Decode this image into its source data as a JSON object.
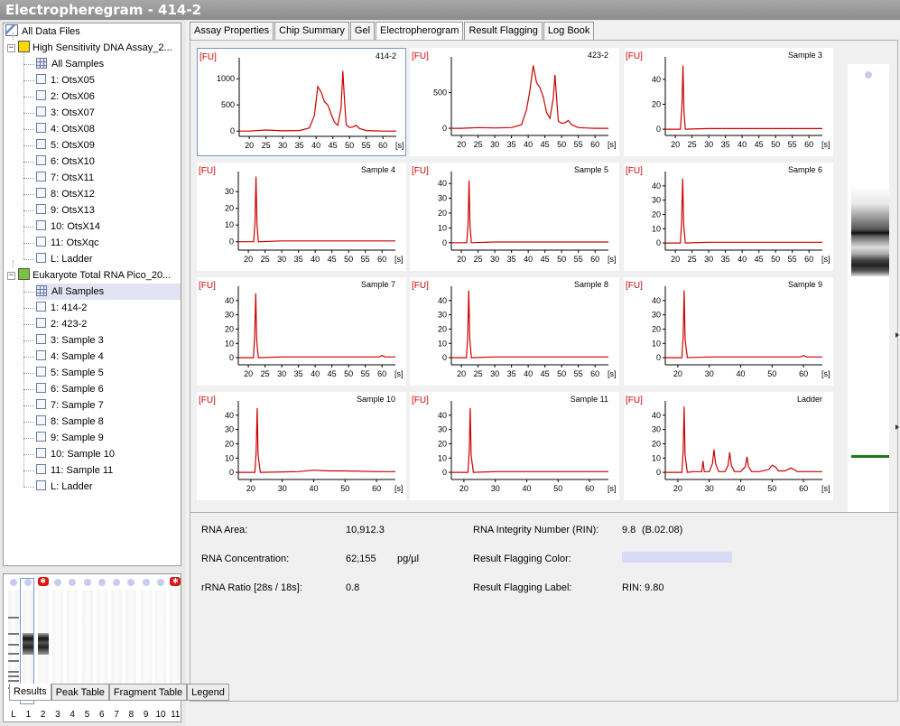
{
  "window": {
    "title": "Electropheregram - 414-2"
  },
  "tree": {
    "root": "All Data Files",
    "assay1": {
      "label": "High Sensitivity DNA Assay_2...",
      "items": [
        "All Samples",
        "1: OtsX05",
        "2: OtsX06",
        "3: OtsX07",
        "4: OtsX08",
        "5: OtsX09",
        "6: OtsX10",
        "7: OtsX11",
        "8: OtsX12",
        "9: OtsX13",
        "10: OtsX14",
        "11: OtsXqc",
        "L: Ladder"
      ]
    },
    "assay2": {
      "label": "Eukaryote Total RNA Pico_20...",
      "items": [
        "All Samples",
        "1: 414-2",
        "2: 423-2",
        "3: Sample 3",
        "4: Sample 4",
        "5: Sample 5",
        "6: Sample 6",
        "7: Sample 7",
        "8: Sample 8",
        "9: Sample 9",
        "10: Sample 10",
        "11: Sample 11",
        "L: Ladder"
      ]
    }
  },
  "gel_lanes": [
    "L",
    "1",
    "2",
    "3",
    "4",
    "5",
    "6",
    "7",
    "8",
    "9",
    "10",
    "11"
  ],
  "tabs": [
    "Assay Properties",
    "Chip Summary",
    "Gel",
    "Electropherogram",
    "Result Flagging",
    "Log Book"
  ],
  "active_tab": "Electropherogram",
  "plots": {
    "y_unit": "[FU]",
    "x_unit": "[s]",
    "cells": [
      {
        "title": "414-2",
        "yticks": [
          "1000",
          "500",
          "0"
        ],
        "xticks": [
          "20",
          "25",
          "30",
          "35",
          "40",
          "45",
          "50",
          "55",
          "60"
        ]
      },
      {
        "title": "423-2",
        "yticks": [
          "500",
          "0"
        ],
        "xticks": [
          "20",
          "25",
          "30",
          "35",
          "40",
          "45",
          "50",
          "55",
          "60"
        ]
      },
      {
        "title": "Sample 3",
        "yticks": [
          "40",
          "20",
          "0"
        ],
        "xticks": [
          "20",
          "25",
          "30",
          "35",
          "40",
          "45",
          "50",
          "55",
          "60"
        ]
      },
      {
        "title": "Sample 4",
        "yticks": [
          "30",
          "20",
          "10",
          "0"
        ],
        "xticks": [
          "20",
          "25",
          "30",
          "35",
          "40",
          "45",
          "50",
          "55",
          "60"
        ]
      },
      {
        "title": "Sample 5",
        "yticks": [
          "40",
          "30",
          "20",
          "10",
          "0"
        ],
        "xticks": [
          "20",
          "25",
          "30",
          "35",
          "40",
          "45",
          "50",
          "55",
          "60"
        ]
      },
      {
        "title": "Sample 6",
        "yticks": [
          "40",
          "30",
          "20",
          "10",
          "0"
        ],
        "xticks": [
          "20",
          "25",
          "30",
          "35",
          "40",
          "45",
          "50",
          "55",
          "60"
        ]
      },
      {
        "title": "Sample 7",
        "yticks": [
          "40",
          "30",
          "20",
          "10",
          "0"
        ],
        "xticks": [
          "20",
          "25",
          "30",
          "35",
          "40",
          "45",
          "50",
          "55",
          "60"
        ]
      },
      {
        "title": "Sample 8",
        "yticks": [
          "40",
          "30",
          "20",
          "10",
          "0"
        ],
        "xticks": [
          "20",
          "25",
          "30",
          "35",
          "40",
          "45",
          "50",
          "55",
          "60"
        ]
      },
      {
        "title": "Sample 9",
        "yticks": [
          "40",
          "30",
          "20",
          "10",
          "0"
        ],
        "xticks": [
          "20",
          "30",
          "40",
          "50",
          "60"
        ]
      },
      {
        "title": "Sample 10",
        "yticks": [
          "40",
          "30",
          "20",
          "10",
          "0"
        ],
        "xticks": [
          "20",
          "30",
          "40",
          "50",
          "60"
        ]
      },
      {
        "title": "Sample 11",
        "yticks": [
          "40",
          "30",
          "20",
          "10",
          "0"
        ],
        "xticks": [
          "20",
          "30",
          "40",
          "50",
          "60"
        ]
      },
      {
        "title": "Ladder",
        "yticks": [
          "40",
          "30",
          "20",
          "10",
          "0"
        ],
        "xticks": [
          "20",
          "30",
          "40",
          "50",
          "60"
        ]
      }
    ]
  },
  "chart_data": [
    {
      "type": "line",
      "title": "414-2",
      "xlabel": "[s]",
      "ylabel": "[FU]",
      "xlim": [
        17,
        64
      ],
      "ylim": [
        -100,
        1400
      ],
      "x": [
        17,
        20,
        25,
        30,
        35,
        38,
        39.5,
        40.5,
        41.5,
        42.5,
        43.5,
        44.5,
        45.5,
        46.5,
        47.5,
        48,
        48.5,
        49,
        50,
        51,
        52,
        53,
        55,
        57,
        60,
        64
      ],
      "y": [
        0,
        0,
        20,
        5,
        10,
        60,
        300,
        850,
        750,
        560,
        500,
        330,
        170,
        110,
        450,
        1150,
        600,
        120,
        70,
        80,
        110,
        50,
        10,
        5,
        0,
        0
      ]
    },
    {
      "type": "line",
      "title": "423-2",
      "xlabel": "[s]",
      "ylabel": "[FU]",
      "xlim": [
        17,
        64
      ],
      "ylim": [
        -100,
        1000
      ],
      "x": [
        17,
        20,
        25,
        30,
        35,
        38,
        39.5,
        40.5,
        41.5,
        42.5,
        43.5,
        44.5,
        45.5,
        46.5,
        47.5,
        48,
        48.5,
        49,
        50,
        51,
        52,
        53,
        55,
        57,
        60,
        64
      ],
      "y": [
        0,
        0,
        10,
        5,
        10,
        50,
        260,
        530,
        880,
        640,
        570,
        440,
        220,
        140,
        420,
        750,
        420,
        100,
        70,
        80,
        110,
        50,
        10,
        5,
        0,
        0
      ]
    },
    {
      "type": "line",
      "title": "Sample 3",
      "xlabel": "[s]",
      "ylabel": "[FU]",
      "xlim": [
        17,
        64
      ],
      "ylim": [
        -5,
        58
      ],
      "x": [
        17,
        21.5,
        22,
        22.3,
        22.6,
        23,
        30,
        45,
        60,
        64
      ],
      "y": [
        0,
        0,
        20,
        51,
        14,
        0,
        0.5,
        0.5,
        0.5,
        0.5
      ]
    },
    {
      "type": "line",
      "title": "Sample 4",
      "xlabel": "[s]",
      "ylabel": "[FU]",
      "xlim": [
        17,
        64
      ],
      "ylim": [
        -5,
        42
      ],
      "x": [
        17,
        21.6,
        22,
        22.3,
        22.6,
        23,
        30,
        45,
        60,
        64
      ],
      "y": [
        0,
        0,
        12,
        39,
        10,
        0,
        0.5,
        0.5,
        0.5,
        0.5
      ]
    },
    {
      "type": "line",
      "title": "Sample 5",
      "xlabel": "[s]",
      "ylabel": "[FU]",
      "xlim": [
        17,
        64
      ],
      "ylim": [
        -5,
        48
      ],
      "x": [
        17,
        21.6,
        22,
        22.3,
        22.6,
        23,
        30,
        45,
        60,
        64
      ],
      "y": [
        0,
        0,
        12,
        42,
        11,
        0,
        0.5,
        0.5,
        0.5,
        0.5
      ]
    },
    {
      "type": "line",
      "title": "Sample 6",
      "xlabel": "[s]",
      "ylabel": "[FU]",
      "xlim": [
        17,
        64
      ],
      "ylim": [
        -5,
        50
      ],
      "x": [
        17,
        21.5,
        21.9,
        22.2,
        22.5,
        23,
        30,
        45,
        60,
        64
      ],
      "y": [
        0,
        0,
        15,
        45,
        12,
        0,
        0.5,
        0.5,
        0.5,
        0.5
      ]
    },
    {
      "type": "line",
      "title": "Sample 7",
      "xlabel": "[s]",
      "ylabel": "[FU]",
      "xlim": [
        17,
        64
      ],
      "ylim": [
        -5,
        50
      ],
      "x": [
        17,
        21.5,
        21.9,
        22.2,
        22.5,
        23,
        30,
        45,
        59,
        60,
        61,
        64
      ],
      "y": [
        0,
        0,
        15,
        45,
        12,
        0,
        0.5,
        0.5,
        0.5,
        1.5,
        0.5,
        0.5
      ]
    },
    {
      "type": "line",
      "title": "Sample 8",
      "xlabel": "[s]",
      "ylabel": "[FU]",
      "xlim": [
        17,
        64
      ],
      "ylim": [
        -5,
        50
      ],
      "x": [
        17,
        21.5,
        21.9,
        22.2,
        22.5,
        23,
        30,
        45,
        60,
        64
      ],
      "y": [
        0,
        0,
        15,
        47,
        13,
        0,
        0.5,
        0.5,
        0.5,
        0.5
      ]
    },
    {
      "type": "line",
      "title": "Sample 9",
      "xlabel": "[s]",
      "ylabel": "[FU]",
      "xlim": [
        16,
        66
      ],
      "ylim": [
        -5,
        50
      ],
      "x": [
        16,
        21.3,
        21.7,
        22,
        22.3,
        23,
        30,
        45,
        59,
        60,
        61,
        66
      ],
      "y": [
        0,
        0,
        15,
        47,
        13,
        0,
        0.5,
        0.5,
        0.5,
        1.5,
        0.5,
        0.5
      ]
    },
    {
      "type": "line",
      "title": "Sample 10",
      "xlabel": "[s]",
      "ylabel": "[FU]",
      "xlim": [
        16,
        66
      ],
      "ylim": [
        -5,
        50
      ],
      "x": [
        16,
        21.3,
        21.7,
        22,
        22.3,
        23,
        35,
        40,
        45,
        50,
        60,
        66
      ],
      "y": [
        0,
        0,
        15,
        45,
        12,
        0,
        0.5,
        1.5,
        1,
        1,
        0.5,
        0.5
      ]
    },
    {
      "type": "line",
      "title": "Sample 11",
      "xlabel": "[s]",
      "ylabel": "[FU]",
      "xlim": [
        16,
        66
      ],
      "ylim": [
        -5,
        50
      ],
      "x": [
        16,
        21.3,
        21.7,
        22,
        22.3,
        23,
        30,
        45,
        60,
        66
      ],
      "y": [
        0,
        0,
        15,
        45,
        12,
        0,
        0.5,
        0.5,
        0.5,
        0.5
      ]
    },
    {
      "type": "line",
      "title": "Ladder",
      "xlabel": "[s]",
      "ylabel": "[FU]",
      "xlim": [
        16,
        66
      ],
      "ylim": [
        -5,
        50
      ],
      "x": [
        16,
        21.3,
        21.7,
        22,
        22.3,
        23,
        25,
        27.6,
        28,
        28.4,
        30,
        31,
        31.5,
        32,
        33,
        35,
        36,
        36.5,
        37,
        38,
        40,
        41.5,
        42,
        42.5,
        43.5,
        46,
        49,
        50,
        51,
        52,
        54,
        55,
        56,
        57,
        58,
        66
      ],
      "y": [
        0,
        0,
        15,
        46,
        12,
        0,
        0.5,
        0.5,
        8,
        0.5,
        0.5,
        6,
        16,
        6,
        0.5,
        0.5,
        5,
        14,
        5,
        0.5,
        0.5,
        4,
        11,
        4,
        0.5,
        0.5,
        2,
        5,
        4,
        1,
        1,
        2,
        3,
        2,
        0.5,
        0.5
      ]
    }
  ],
  "gel_col": {
    "lane": "1"
  },
  "results": {
    "rna_area_label": "RNA Area:",
    "rna_area": "10,912.3",
    "rna_conc_label": "RNA Concentration:",
    "rna_conc": "62,155",
    "rna_conc_unit": "pg/µl",
    "rrna_ratio_label": "rRNA Ratio [28s / 18s]:",
    "rrna_ratio": "0.8",
    "rin_label": "RNA Integrity Number (RIN):",
    "rin": "9.8",
    "rin_version": "(B.02.08)",
    "flag_color_label": "Result Flagging Color:",
    "flag_color": "#d9dbf6",
    "flag_label_label": "Result Flagging Label:",
    "flag_label": "RIN: 9.80"
  },
  "bottom_tabs": [
    "Results",
    "Peak Table",
    "Fragment Table",
    "Legend"
  ],
  "colors": {
    "trace": "#cc0000",
    "axis": "#000000",
    "fu_label": "#cc0000",
    "marker_green": "#1a7a1a"
  }
}
